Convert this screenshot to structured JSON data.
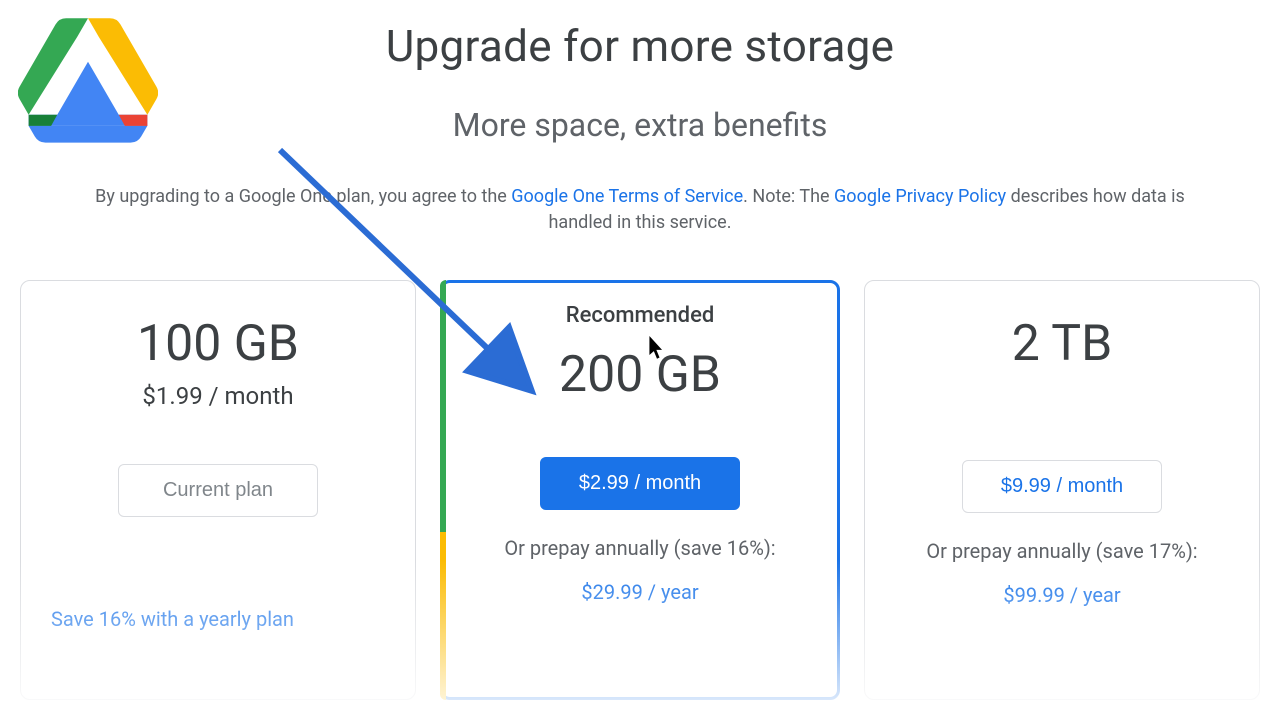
{
  "header": {
    "title": "Upgrade for more storage",
    "subtitle": "More space, extra benefits"
  },
  "disclaimer": {
    "prefix": "By upgrading to a Google One plan, you agree to the ",
    "link1": "Google One Terms of Service",
    "mid": ". Note: The ",
    "link2": "Google Privacy Policy",
    "suffix": " describes how data is handled in this service."
  },
  "plans": {
    "p1": {
      "size": "100 GB",
      "price_text": "$1.99 / month",
      "button": "Current plan",
      "yearly_link": "Save 16% with a yearly plan"
    },
    "p2": {
      "recommended": "Recommended",
      "size": "200 GB",
      "button": "$2.99 / month",
      "prepay": "Or prepay annually (save 16%):",
      "annual": "$29.99 / year"
    },
    "p3": {
      "size": "2 TB",
      "button": "$9.99 / month",
      "prepay": "Or prepay annually (save 17%):",
      "annual": "$99.99 / year"
    }
  }
}
